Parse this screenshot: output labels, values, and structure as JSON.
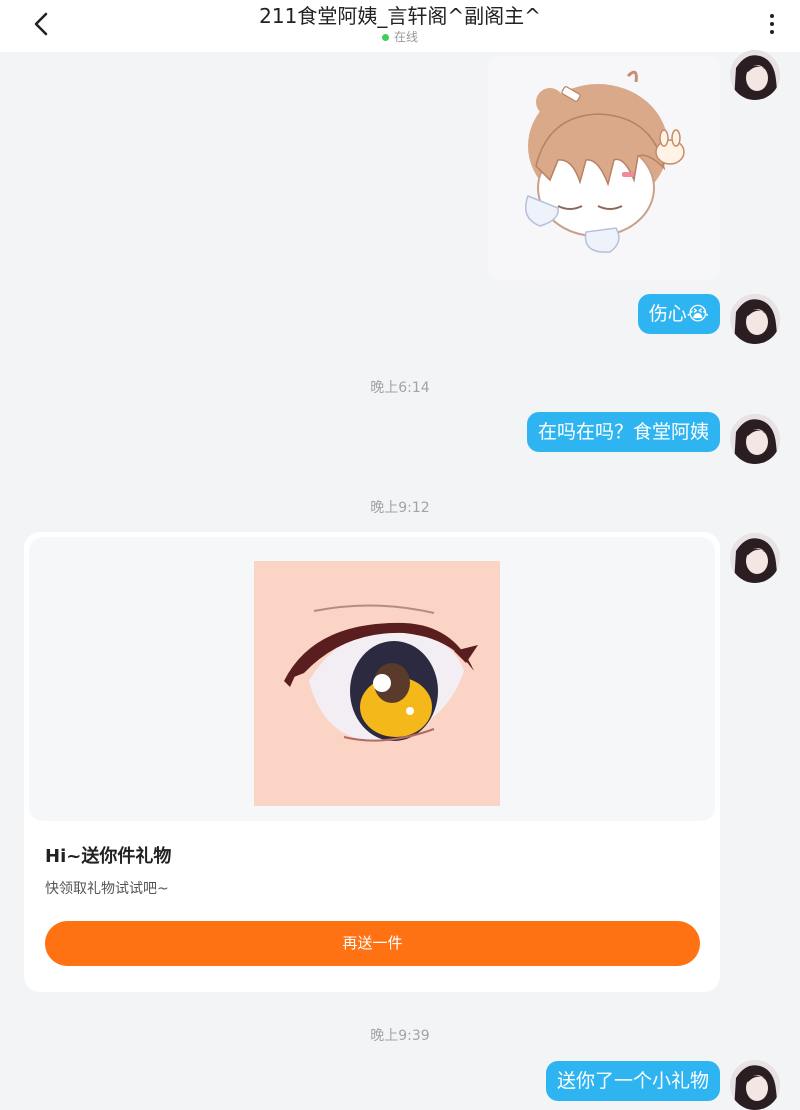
{
  "header": {
    "title": "211食堂阿姨_言轩阁^副阁主^",
    "status_text": "在线",
    "status_color": "#3ecf5a",
    "back_icon": "chevron-left-icon",
    "more_icon": "more-vertical-icon"
  },
  "messages": [
    {
      "type": "sticker",
      "sender": "self",
      "description_icon": "anime-girl-sticker"
    },
    {
      "type": "text",
      "sender": "self",
      "text": "伤心😭"
    },
    {
      "type": "time",
      "text": "晚上6:14"
    },
    {
      "type": "text",
      "sender": "self",
      "text": "在吗在吗？食堂阿姨"
    },
    {
      "type": "time",
      "text": "晚上9:12"
    },
    {
      "type": "gift_card",
      "sender": "self",
      "title": "Hi~送你件礼物",
      "subtitle": "快领取礼物试试吧~",
      "button_label": "再送一件"
    },
    {
      "type": "time",
      "text": "晚上9:39"
    },
    {
      "type": "text",
      "sender": "self",
      "text": "送你了一个小礼物"
    }
  ],
  "colors": {
    "bubble": "#2fb4f2",
    "gift_button": "#ff7214",
    "background": "#f3f4f6"
  }
}
